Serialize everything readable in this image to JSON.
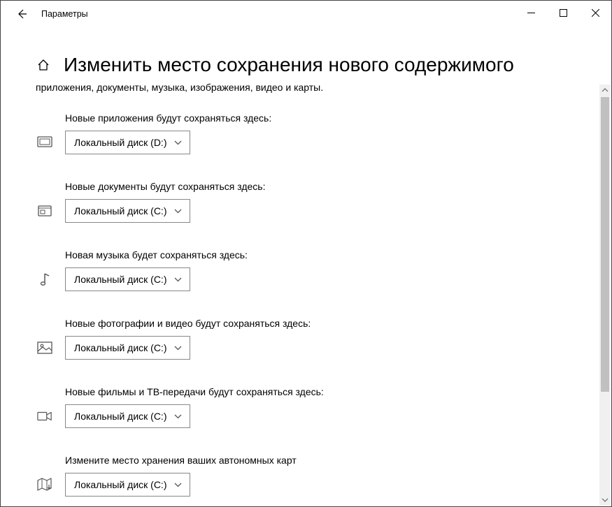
{
  "window": {
    "title": "Параметры"
  },
  "page": {
    "title": "Изменить место сохранения нового содержимого",
    "subtitle": "приложения, документы, музыка, изображения, видео и карты."
  },
  "settings": [
    {
      "label": "Новые приложения будут сохраняться здесь:",
      "value": "Локальный диск (D:)",
      "icon": "app-icon"
    },
    {
      "label": "Новые документы будут сохраняться здесь:",
      "value": "Локальный диск (C:)",
      "icon": "document-icon"
    },
    {
      "label": "Новая музыка будет сохраняться здесь:",
      "value": "Локальный диск (C:)",
      "icon": "music-icon"
    },
    {
      "label": "Новые фотографии и видео будут сохраняться здесь:",
      "value": "Локальный диск (C:)",
      "icon": "photo-icon"
    },
    {
      "label": "Новые фильмы и ТВ-передачи будут сохраняться здесь:",
      "value": "Локальный диск (C:)",
      "icon": "video-icon"
    },
    {
      "label": "Измените место хранения ваших автономных карт",
      "value": "Локальный диск (C:)",
      "icon": "map-icon"
    }
  ]
}
